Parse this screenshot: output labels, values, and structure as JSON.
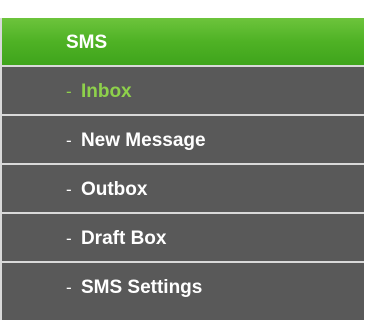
{
  "menu": {
    "header": "SMS",
    "active_color": "#8ed14b",
    "header_color": "#4fb225",
    "item_bg": "#595959",
    "items": [
      {
        "label": "Inbox",
        "active": true
      },
      {
        "label": "New Message",
        "active": false
      },
      {
        "label": "Outbox",
        "active": false
      },
      {
        "label": "Draft Box",
        "active": false
      },
      {
        "label": "SMS Settings",
        "active": false
      }
    ],
    "bullet": "-"
  }
}
